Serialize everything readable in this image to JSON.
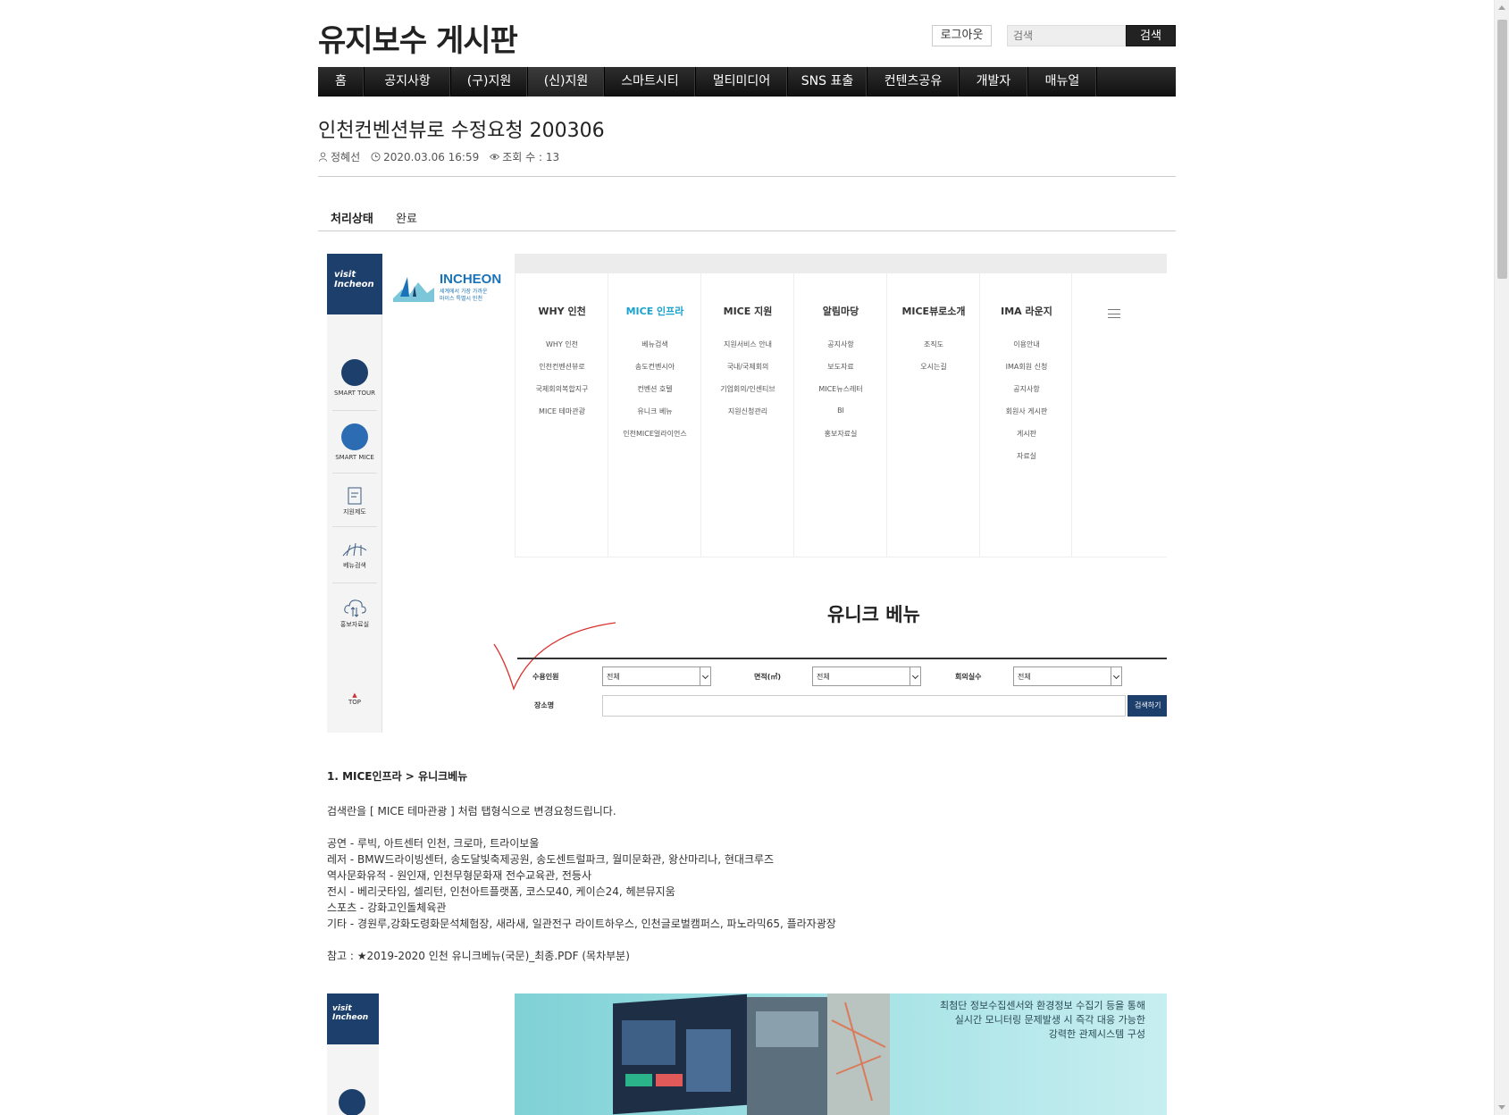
{
  "header": {
    "site_title": "유지보수 게시판",
    "logout_label": "로그아웃",
    "search_placeholder": "검색",
    "search_button": "검색"
  },
  "nav": {
    "items": [
      "홈",
      "공지사항",
      "(구)지원",
      "(신)지원",
      "스마트시티",
      "멀티미디어",
      "SNS 표출",
      "컨텐츠공유",
      "개발자",
      "매뉴얼"
    ],
    "active": "(신)지원"
  },
  "post": {
    "title": "인천컨벤션뷰로 수정요청 200306",
    "author": "정혜선",
    "datetime": "2020.03.06 16:59",
    "views": "조회 수 : 13",
    "status_label": "처리상태",
    "status_value": "완료"
  },
  "screenshot1": {
    "visit_logo": [
      "visit",
      "Incheon"
    ],
    "side_items": [
      "SMART TOUR",
      "SMART MICE",
      "지원제도",
      "베뉴검색",
      "홍보자료실",
      "TOP"
    ],
    "logo_word": "INCHEON",
    "logo_sub": [
      "세계에서 가장 가까운",
      "마이스 특별시 인천"
    ],
    "menu": [
      {
        "head": "WHY 인천",
        "subs": [
          "WHY 인천",
          "인천컨벤션뷰로",
          "국제회의복합지구",
          "MICE 테마관광"
        ]
      },
      {
        "head": "MICE 인프라",
        "subs": [
          "베뉴검색",
          "송도컨벤시아",
          "컨벤션 호텔",
          "유니크 베뉴",
          "인천MICE얼라이언스"
        ]
      },
      {
        "head": "MICE 지원",
        "subs": [
          "지원서비스 안내",
          "국내/국제회의",
          "기업회의/인센티브",
          "지원신청관리"
        ]
      },
      {
        "head": "알림마당",
        "subs": [
          "공지사항",
          "보도자료",
          "MICE뉴스레터",
          "BI",
          "홍보자료실"
        ]
      },
      {
        "head": "MICE뷰로소개",
        "subs": [
          "조직도",
          "오시는길"
        ]
      },
      {
        "head": "IMA 라운지",
        "subs": [
          "이용안내",
          "IMA회원 신청",
          "공지사항",
          "회원사 게시판",
          "게시판",
          "자료실"
        ]
      }
    ],
    "active_menu": "MICE 인프라",
    "section_title": "유니크 베뉴",
    "form": {
      "capacity_label": "수용인원",
      "capacity_value": "전체",
      "area_label": "면적(㎡)",
      "area_value": "전체",
      "rooms_label": "회의실수",
      "rooms_value": "전체",
      "place_label": "장소명",
      "search_button": "검색하기"
    }
  },
  "content": {
    "heading": "1. MICE인프라 > 유니크베뉴",
    "request": "검색란을 [ MICE 테마관광 ] 처럼 탭형식으로 변경요청드립니다.",
    "lines": [
      "공연 - 루빅, 아트센터 인천, 크로마, 트라이보울",
      "레저 - BMW드라이빙센터, 송도달빛축제공원, 송도센트럴파크, 월미문화관, 왕산마리나, 현대크루즈",
      "역사문화유적 - 원인재, 인천무형문화재 전수교육관, 전등사",
      "전시 - 베리굿타임, 셀리턴, 인천아트플랫폼, 코스모40, 케이슨24, 헤븐뮤지움",
      "스포츠 - 강화고인돌체육관",
      "기타 - 경원루,강화도령화문석체험장, 새라새, 일관전구 라이트하우스, 인천글로벌캠퍼스, 파노라믹65, 플라자광장"
    ],
    "reference": "참고 : ★2019-2020 인천 유니크베뉴(국문)_최종.PDF (목차부분)"
  },
  "screenshot2": {
    "visit_logo": [
      "visit",
      "Incheon"
    ],
    "banner_text": [
      "최첨단 정보수집센서와 환경정보 수집기 등을 통해",
      "실시간 모니터링 문제발생 시 즉각 대응 가능한",
      "강력한 관제시스템 구성"
    ]
  },
  "colors": {
    "nav_bg": "#1a1a1a",
    "accent_blue": "#1d3f6b",
    "active_menu": "#18a3cf",
    "annotation_red": "#d9302c"
  }
}
